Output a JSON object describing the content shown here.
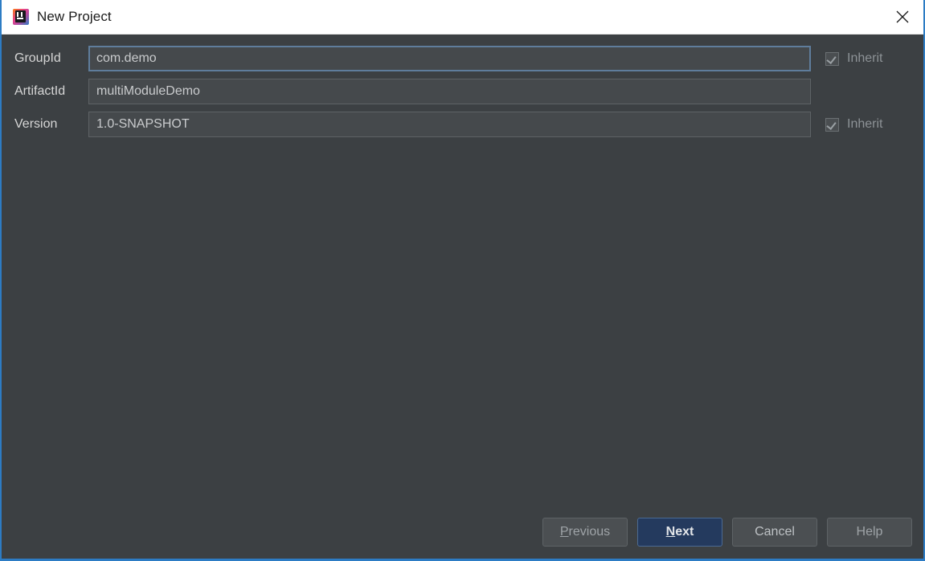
{
  "window": {
    "title": "New Project",
    "app_icon": "intellij-idea-icon",
    "close_icon": "close-icon",
    "accent_color": "#2d7cc4",
    "panel_color": "#3c4043"
  },
  "form": {
    "rows": [
      {
        "label": "GroupId",
        "value": "com.demo",
        "placeholder": "",
        "field_name": "group-id-field",
        "focused": true,
        "inherit": {
          "visible": true,
          "label": "Inherit",
          "checked": true,
          "disabled": true
        }
      },
      {
        "label": "ArtifactId",
        "value": "multiModuleDemo",
        "placeholder": "",
        "field_name": "artifact-id-field",
        "focused": false,
        "inherit": {
          "visible": false,
          "label": "",
          "checked": false,
          "disabled": true
        }
      },
      {
        "label": "Version",
        "value": "1.0-SNAPSHOT",
        "placeholder": "",
        "field_name": "version-field",
        "focused": false,
        "inherit": {
          "visible": true,
          "label": "Inherit",
          "checked": true,
          "disabled": true
        }
      }
    ]
  },
  "footer": {
    "buttons": [
      {
        "name": "previous-button",
        "label": "Previous",
        "mnemonic": "P",
        "style": "dim"
      },
      {
        "name": "next-button",
        "label": "Next",
        "mnemonic": "N",
        "style": "primary"
      },
      {
        "name": "cancel-button",
        "label": "Cancel",
        "mnemonic": "",
        "style": "default"
      },
      {
        "name": "help-button",
        "label": "Help",
        "mnemonic": "",
        "style": "dim"
      }
    ]
  }
}
